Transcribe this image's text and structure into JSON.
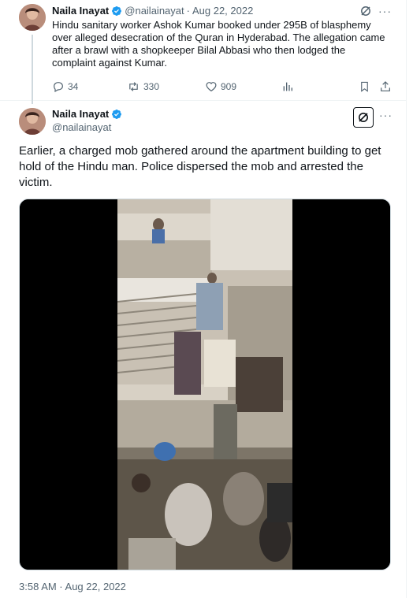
{
  "tweet1": {
    "author_name": "Naila Inayat",
    "handle": "@nailainayat",
    "separator": "·",
    "date": "Aug 22, 2022",
    "text": "Hindu sanitary worker Ashok Kumar booked under 295B of blasphemy over alleged desecration of the Quran in Hyderabad. The allegation came after a brawl with a shopkeeper Bilal Abbasi who then lodged the complaint against Kumar.",
    "more_label": "···",
    "actions": {
      "replies": "34",
      "reposts": "330",
      "likes": "909"
    }
  },
  "tweet2": {
    "author_name": "Naila Inayat",
    "handle": "@nailainayat",
    "more_label": "···",
    "text": "Earlier, a charged mob gathered around the apartment building to get hold of the Hindu man. Police dispersed the mob and arrested the victim.",
    "timestamp": "3:58 AM · Aug 22, 2022"
  },
  "colors": {
    "verified_blue": "#1d9bf0",
    "muted_text": "#536471",
    "primary_text": "#0f1419",
    "divider": "#eff3f4"
  },
  "icons": [
    "verified-badge-icon",
    "grok-icon",
    "more-icon",
    "reply-icon",
    "repost-icon",
    "like-icon",
    "views-icon",
    "bookmark-icon",
    "share-icon"
  ]
}
